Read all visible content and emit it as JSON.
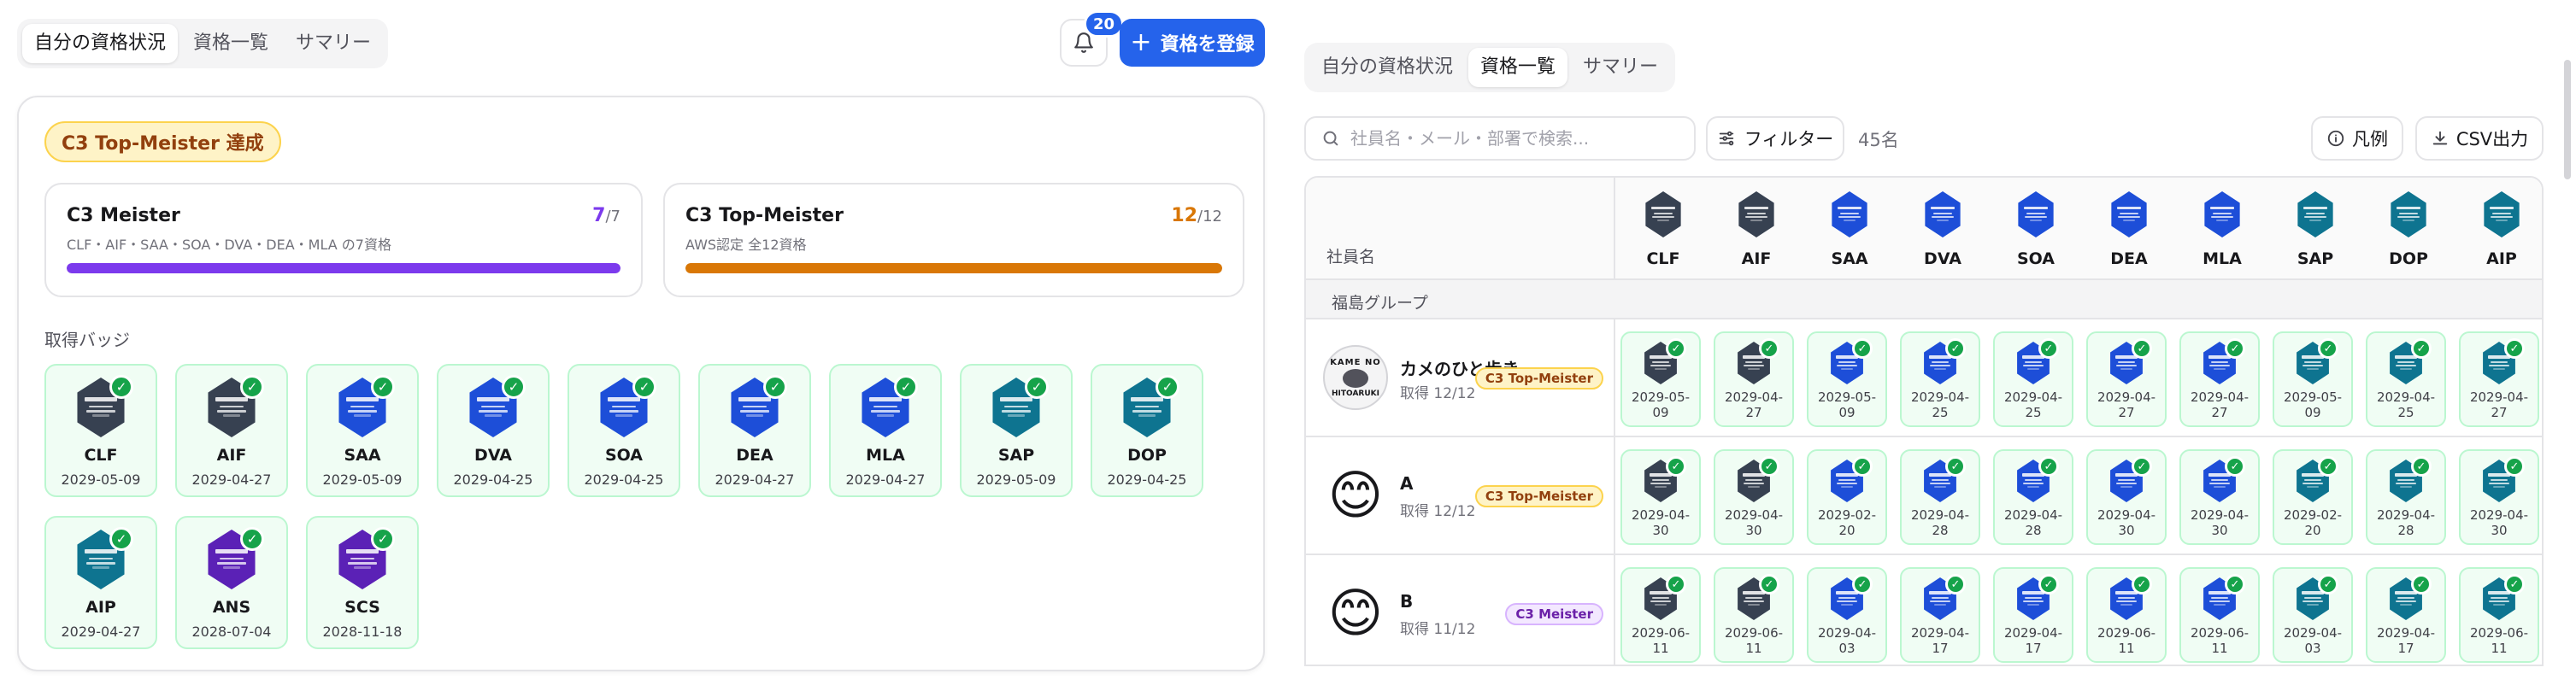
{
  "colors": {
    "accent": "#2563eb",
    "success": "#16a34a",
    "meister": "#7c3aed",
    "topmeister": "#d97706",
    "cert_dark": "#374151",
    "cert_blue": "#1d4ed8",
    "cert_teal": "#0e7490",
    "cert_purple": "#5b21b6"
  },
  "left": {
    "tabs": [
      {
        "label": "自分の資格状況",
        "active": true
      },
      {
        "label": "資格一覧",
        "active": false
      },
      {
        "label": "サマリー",
        "active": false
      }
    ],
    "notification_count": "20",
    "register_label": "資格を登録",
    "achievement": "C3 Top-Meister 達成",
    "progress": [
      {
        "title": "C3 Meister",
        "subtitle": "CLF・AIF・SAA・SOA・DVA・DEA・MLA の7資格",
        "done": "7",
        "total": "/7",
        "fraction": 1.0
      },
      {
        "title": "C3 Top-Meister",
        "subtitle": "AWS認定 全12資格",
        "done": "12",
        "total": "/12",
        "fraction": 1.0
      }
    ],
    "badges_label": "取得バッジ",
    "badges": [
      {
        "code": "CLF",
        "date": "2029-05-09",
        "tone": "dark"
      },
      {
        "code": "AIF",
        "date": "2029-04-27",
        "tone": "dark"
      },
      {
        "code": "SAA",
        "date": "2029-05-09",
        "tone": "blue"
      },
      {
        "code": "DVA",
        "date": "2029-04-25",
        "tone": "blue"
      },
      {
        "code": "SOA",
        "date": "2029-04-25",
        "tone": "blue"
      },
      {
        "code": "DEA",
        "date": "2029-04-27",
        "tone": "blue"
      },
      {
        "code": "MLA",
        "date": "2029-04-27",
        "tone": "blue"
      },
      {
        "code": "SAP",
        "date": "2029-05-09",
        "tone": "teal"
      },
      {
        "code": "DOP",
        "date": "2029-04-25",
        "tone": "teal"
      },
      {
        "code": "AIP",
        "date": "2029-04-27",
        "tone": "teal"
      },
      {
        "code": "ANS",
        "date": "2028-07-04",
        "tone": "purple"
      },
      {
        "code": "SCS",
        "date": "2028-11-18",
        "tone": "purple"
      }
    ]
  },
  "right": {
    "tabs": [
      {
        "label": "自分の資格状況",
        "active": false
      },
      {
        "label": "資格一覧",
        "active": true
      },
      {
        "label": "サマリー",
        "active": false
      }
    ],
    "search_placeholder": "社員名・メール・部署で検索...",
    "filter_label": "フィルター",
    "count_label": "45名",
    "legend_label": "凡例",
    "csv_label": "CSV出力",
    "name_header": "社員名",
    "columns": [
      {
        "code": "CLF",
        "tone": "dark"
      },
      {
        "code": "AIF",
        "tone": "dark"
      },
      {
        "code": "SAA",
        "tone": "blue"
      },
      {
        "code": "DVA",
        "tone": "blue"
      },
      {
        "code": "SOA",
        "tone": "blue"
      },
      {
        "code": "DEA",
        "tone": "blue"
      },
      {
        "code": "MLA",
        "tone": "blue"
      },
      {
        "code": "SAP",
        "tone": "teal"
      },
      {
        "code": "DOP",
        "tone": "teal"
      },
      {
        "code": "AIP",
        "tone": "teal"
      }
    ],
    "group": "福島グループ",
    "rows": [
      {
        "name": "カメのひと歩き",
        "sub": "取得 12/12",
        "tag": "C3 Top-Meister",
        "tag_type": "top",
        "avatar": "logo",
        "avatar_text1": "KAME NO",
        "avatar_text2": "HITOARUKI",
        "dates": [
          "2029-05-09",
          "2029-04-27",
          "2029-05-09",
          "2029-04-25",
          "2029-04-25",
          "2029-04-27",
          "2029-04-27",
          "2029-05-09",
          "2029-04-25",
          "2029-04-27"
        ]
      },
      {
        "name": "A",
        "sub": "取得 12/12",
        "tag": "C3 Top-Meister",
        "tag_type": "top",
        "avatar": "emoji",
        "avatar_glyph": "😊",
        "dates": [
          "2029-04-30",
          "2029-04-30",
          "2029-02-20",
          "2029-04-28",
          "2029-04-28",
          "2029-04-30",
          "2029-04-30",
          "2029-02-20",
          "2029-04-28",
          "2029-04-30"
        ]
      },
      {
        "name": "B",
        "sub": "取得 11/12",
        "tag": "C3 Meister",
        "tag_type": "meister",
        "avatar": "emoji",
        "avatar_glyph": "😊",
        "dates": [
          "2029-06-11",
          "2029-06-11",
          "2029-04-03",
          "2029-04-17",
          "2029-04-17",
          "2029-06-11",
          "2029-06-11",
          "2029-04-03",
          "2029-04-17",
          "2029-06-11"
        ]
      }
    ]
  }
}
